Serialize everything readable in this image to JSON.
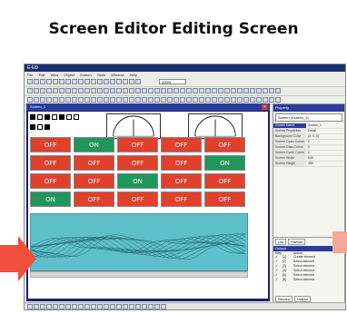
{
  "heading": "Screen Editor Editing Screen",
  "app": {
    "title": "E-ED",
    "menu": [
      "File",
      "Edit",
      "View",
      "Object",
      "Screen",
      "Tools",
      "Window",
      "Help"
    ],
    "zoom": "100%"
  },
  "screen_window": {
    "title": "Screen_1"
  },
  "buttons": [
    [
      "OFF",
      "ON",
      "OFF",
      "OFF",
      "OFF"
    ],
    [
      "OFF",
      "OFF",
      "OFF",
      "OFF",
      "ON"
    ],
    [
      "OFF",
      "OFF",
      "ON",
      "OFF",
      "OFF"
    ],
    [
      "ON",
      "OFF",
      "OFF",
      "OFF",
      "OFF"
    ]
  ],
  "properties": {
    "title": "Property",
    "object": "Screen (Screen_1)",
    "rows": [
      {
        "key": "Screen Name",
        "value": "Screen_1"
      },
      {
        "key": "Screen Properties",
        "value": "Detail"
      },
      {
        "key": "Background Color",
        "value": "(0, 0, 0)"
      },
      {
        "key": "Screen Open Colors",
        "value": "0"
      },
      {
        "key": "Screen Data Colors",
        "value": "0"
      },
      {
        "key": "Screen Cycle Colors",
        "value": "0"
      },
      {
        "key": "Screen Width",
        "value": "640"
      },
      {
        "key": "Screen Height",
        "value": "480"
      }
    ]
  },
  "output": {
    "tabs": [
      "List",
      "Partner"
    ],
    "title": "Output",
    "columns": [
      "Step",
      "Action"
    ],
    "rows": [
      {
        "step": "[1]",
        "action": "Create element"
      },
      {
        "step": "[2]",
        "action": "Select element"
      },
      {
        "step": "[3]",
        "action": "Select element"
      },
      {
        "step": "[4]",
        "action": "Select element"
      },
      {
        "step": "[5]",
        "action": "Select element"
      },
      {
        "step": "[6]",
        "action": "Select element"
      }
    ],
    "bottom_tabs": [
      "Record",
      "Output"
    ]
  },
  "colors": {
    "off": "#e0402c",
    "on": "#20965c",
    "canvas_bg": "#1e1e6a",
    "trend_bg": "#5ec0cb",
    "arrow": "#ef4f3c"
  }
}
